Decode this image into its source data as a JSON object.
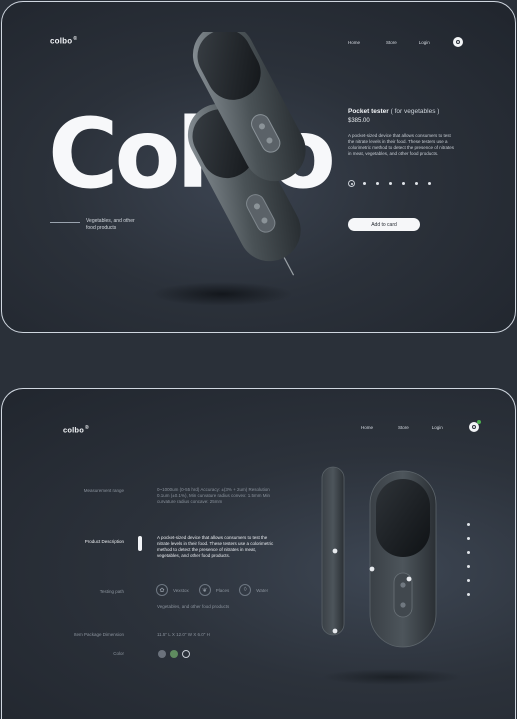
{
  "top": {
    "logo": "colbo",
    "nav": {
      "home": "Home",
      "store": "Store",
      "login": "Login"
    },
    "hero_word": "Colbo",
    "hero_subtitle": "Vegetables, and other food products",
    "product": {
      "name": "Pocket tester",
      "variant": "( for vegetables )",
      "price": "$385.00",
      "description": "A pocket-sized device that allows consumers to test the nitrate levels in their food. These testers use a colorimetric method to detect the presence of nitrates in meat, vegetables, and other food products."
    },
    "carousel_count": 7,
    "carousel_active": 1,
    "add_to_cart": "Add to card"
  },
  "bottom": {
    "logo": "colbo",
    "nav": {
      "home": "Home",
      "store": "Store",
      "login": "Login"
    },
    "specs": {
      "measurement_label": "Measurement range",
      "measurement_value": "0~1000um (0-55 hrd) Accuracy: ±(3% + 2um) Resolution 0.1um (±0.1%), Min curvature radius convex: 1.5mm Min curvature radius concave: 25mm",
      "description_label": "Product Description",
      "description_value": "A pocket-sized device that allows consumers to test the nitrate levels in their food. These testers use a colorimetric method to detect the presence of nitrates in meat, vegetables, and other food products.",
      "testing_label": "Testing path",
      "testing_options": [
        "Vexstox",
        "Places",
        "Water"
      ],
      "testing_note": "Vegetables, and other food products",
      "dimension_label": "Item Package Dimension",
      "dimension_value": "11.5\" L X 12.0\" W X 6.0\" H",
      "color_label": "Color"
    },
    "colors": [
      "#6b727c",
      "#5f8b5f",
      "#2b313a"
    ],
    "side_dots_count": 6
  }
}
